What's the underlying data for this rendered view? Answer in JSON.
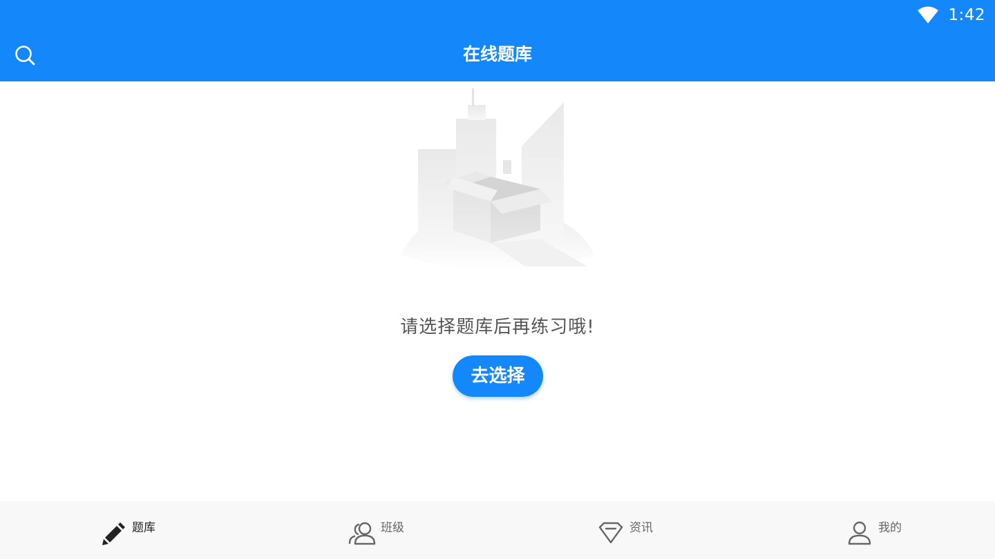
{
  "status_bar": {
    "time": "1:42",
    "wifi_icon": "wifi-icon"
  },
  "header": {
    "title": "在线题库",
    "search_icon": "search-icon",
    "color": "#1488fa"
  },
  "empty_state": {
    "illustration": "empty-box-city-illustration",
    "message": "请选择题库后再练习哦!",
    "button_label": "去选择"
  },
  "bottom_nav": {
    "items": [
      {
        "label": "题库",
        "icon": "pencil-icon",
        "active": true
      },
      {
        "label": "班级",
        "icon": "users-icon",
        "active": false
      },
      {
        "label": "资讯",
        "icon": "diamond-icon",
        "active": false
      },
      {
        "label": "我的",
        "icon": "user-icon",
        "active": false
      }
    ]
  }
}
